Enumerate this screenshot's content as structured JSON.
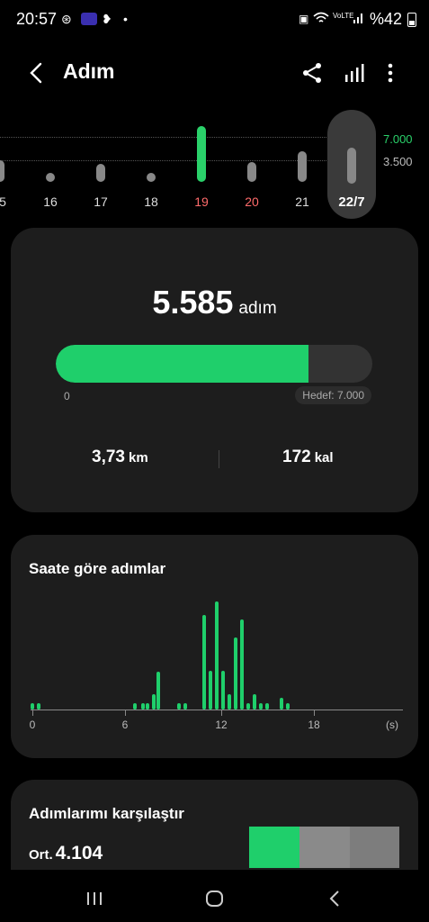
{
  "status": {
    "time": "20:57",
    "battery": "%42",
    "signal_label": "VoLTE"
  },
  "app": {
    "title": "Adım"
  },
  "days": {
    "labels": [
      "5",
      "16",
      "17",
      "18",
      "19",
      "20",
      "21"
    ],
    "selected": "22/7",
    "goal_label": "7.000",
    "half_label": "3.500"
  },
  "summary": {
    "steps": "5.585",
    "steps_unit": "adım",
    "progress_fraction": 0.798,
    "zero": "0",
    "goal": "Hedef: 7.000",
    "distance": "3,73",
    "distance_unit": "km",
    "calories": "172",
    "calories_unit": "kal"
  },
  "hourly": {
    "title": "Saate göre adımlar",
    "x_ticks": [
      "0",
      "6",
      "12",
      "18",
      "(s)"
    ],
    "chart_data": {
      "type": "bar",
      "xlabel": "(s)",
      "x": [
        0.0,
        0.4,
        6.5,
        7.0,
        7.3,
        7.7,
        8.0,
        9.3,
        9.7,
        10.9,
        11.3,
        11.7,
        12.1,
        12.5,
        12.9,
        13.3,
        13.7,
        14.1,
        14.5,
        14.9,
        15.8,
        16.2
      ],
      "values": [
        4,
        4,
        4,
        4,
        4,
        10,
        25,
        4,
        4,
        63,
        26,
        72,
        26,
        10,
        48,
        60,
        4,
        10,
        4,
        4,
        8,
        4
      ]
    }
  },
  "compare": {
    "title": "Adımlarımı karşılaştır",
    "prefix": "Ort.",
    "average": "4.104",
    "colors": [
      "#1fcf6b",
      "#8a8a8a",
      "#8a8a8a"
    ]
  },
  "colors": {
    "accent": "#1fcf6b",
    "card": "#1d1d1d",
    "weekend": "#ff6b6b"
  }
}
